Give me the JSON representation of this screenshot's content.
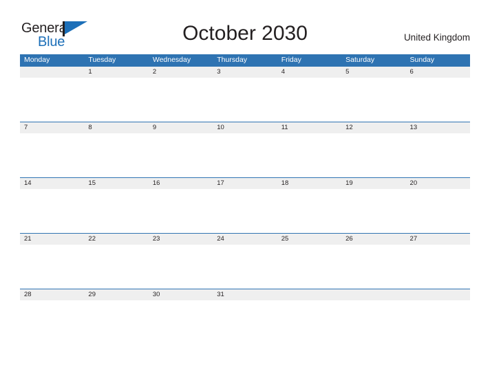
{
  "brand": {
    "name_part1": "General",
    "name_part2": "Blue",
    "icon": "flag-triangle-icon",
    "color_dark": "#231f20",
    "color_blue": "#1c6fb8"
  },
  "header": {
    "title": "October 2030",
    "country": "United Kingdom"
  },
  "theme": {
    "header_blue": "#2e73b2",
    "date_strip_gray": "#efefef",
    "cell_white": "#ffffff",
    "text_dark": "#231f20",
    "text_on_blue": "#ffffff"
  },
  "calendar": {
    "month": "October",
    "year": "2030",
    "weekday_headers": [
      "Monday",
      "Tuesday",
      "Wednesday",
      "Thursday",
      "Friday",
      "Saturday",
      "Sunday"
    ],
    "weeks": [
      {
        "days": [
          "",
          "1",
          "2",
          "3",
          "4",
          "5",
          "6"
        ]
      },
      {
        "days": [
          "7",
          "8",
          "9",
          "10",
          "11",
          "12",
          "13"
        ]
      },
      {
        "days": [
          "14",
          "15",
          "16",
          "17",
          "18",
          "19",
          "20"
        ]
      },
      {
        "days": [
          "21",
          "22",
          "23",
          "24",
          "25",
          "26",
          "27"
        ]
      },
      {
        "days": [
          "28",
          "29",
          "30",
          "31",
          "",
          "",
          ""
        ]
      }
    ]
  }
}
